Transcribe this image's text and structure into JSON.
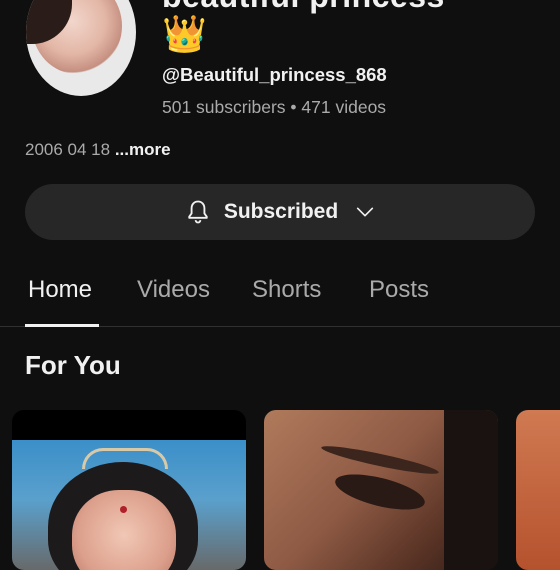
{
  "channel": {
    "title_visible": "beautiful princess",
    "crown_emoji": "👑",
    "handle": "@Beautiful_princess_868",
    "subscribers": "501 subscribers",
    "separator": " • ",
    "videos": "471 videos",
    "description": "2006 04 18",
    "more_label": "...more"
  },
  "subscribe": {
    "label": "Subscribed",
    "icons": [
      "bell-icon",
      "chevron-down-icon"
    ]
  },
  "tabs": [
    {
      "label": "Home",
      "active": true
    },
    {
      "label": "Videos",
      "active": false
    },
    {
      "label": "Shorts",
      "active": false
    },
    {
      "label": "Posts",
      "active": false
    }
  ],
  "section": {
    "title": "For You"
  },
  "colors": {
    "background": "#0f0f0f",
    "surface": "#272727",
    "text_primary": "#f1f1f1",
    "text_secondary": "#aaaaaa"
  }
}
